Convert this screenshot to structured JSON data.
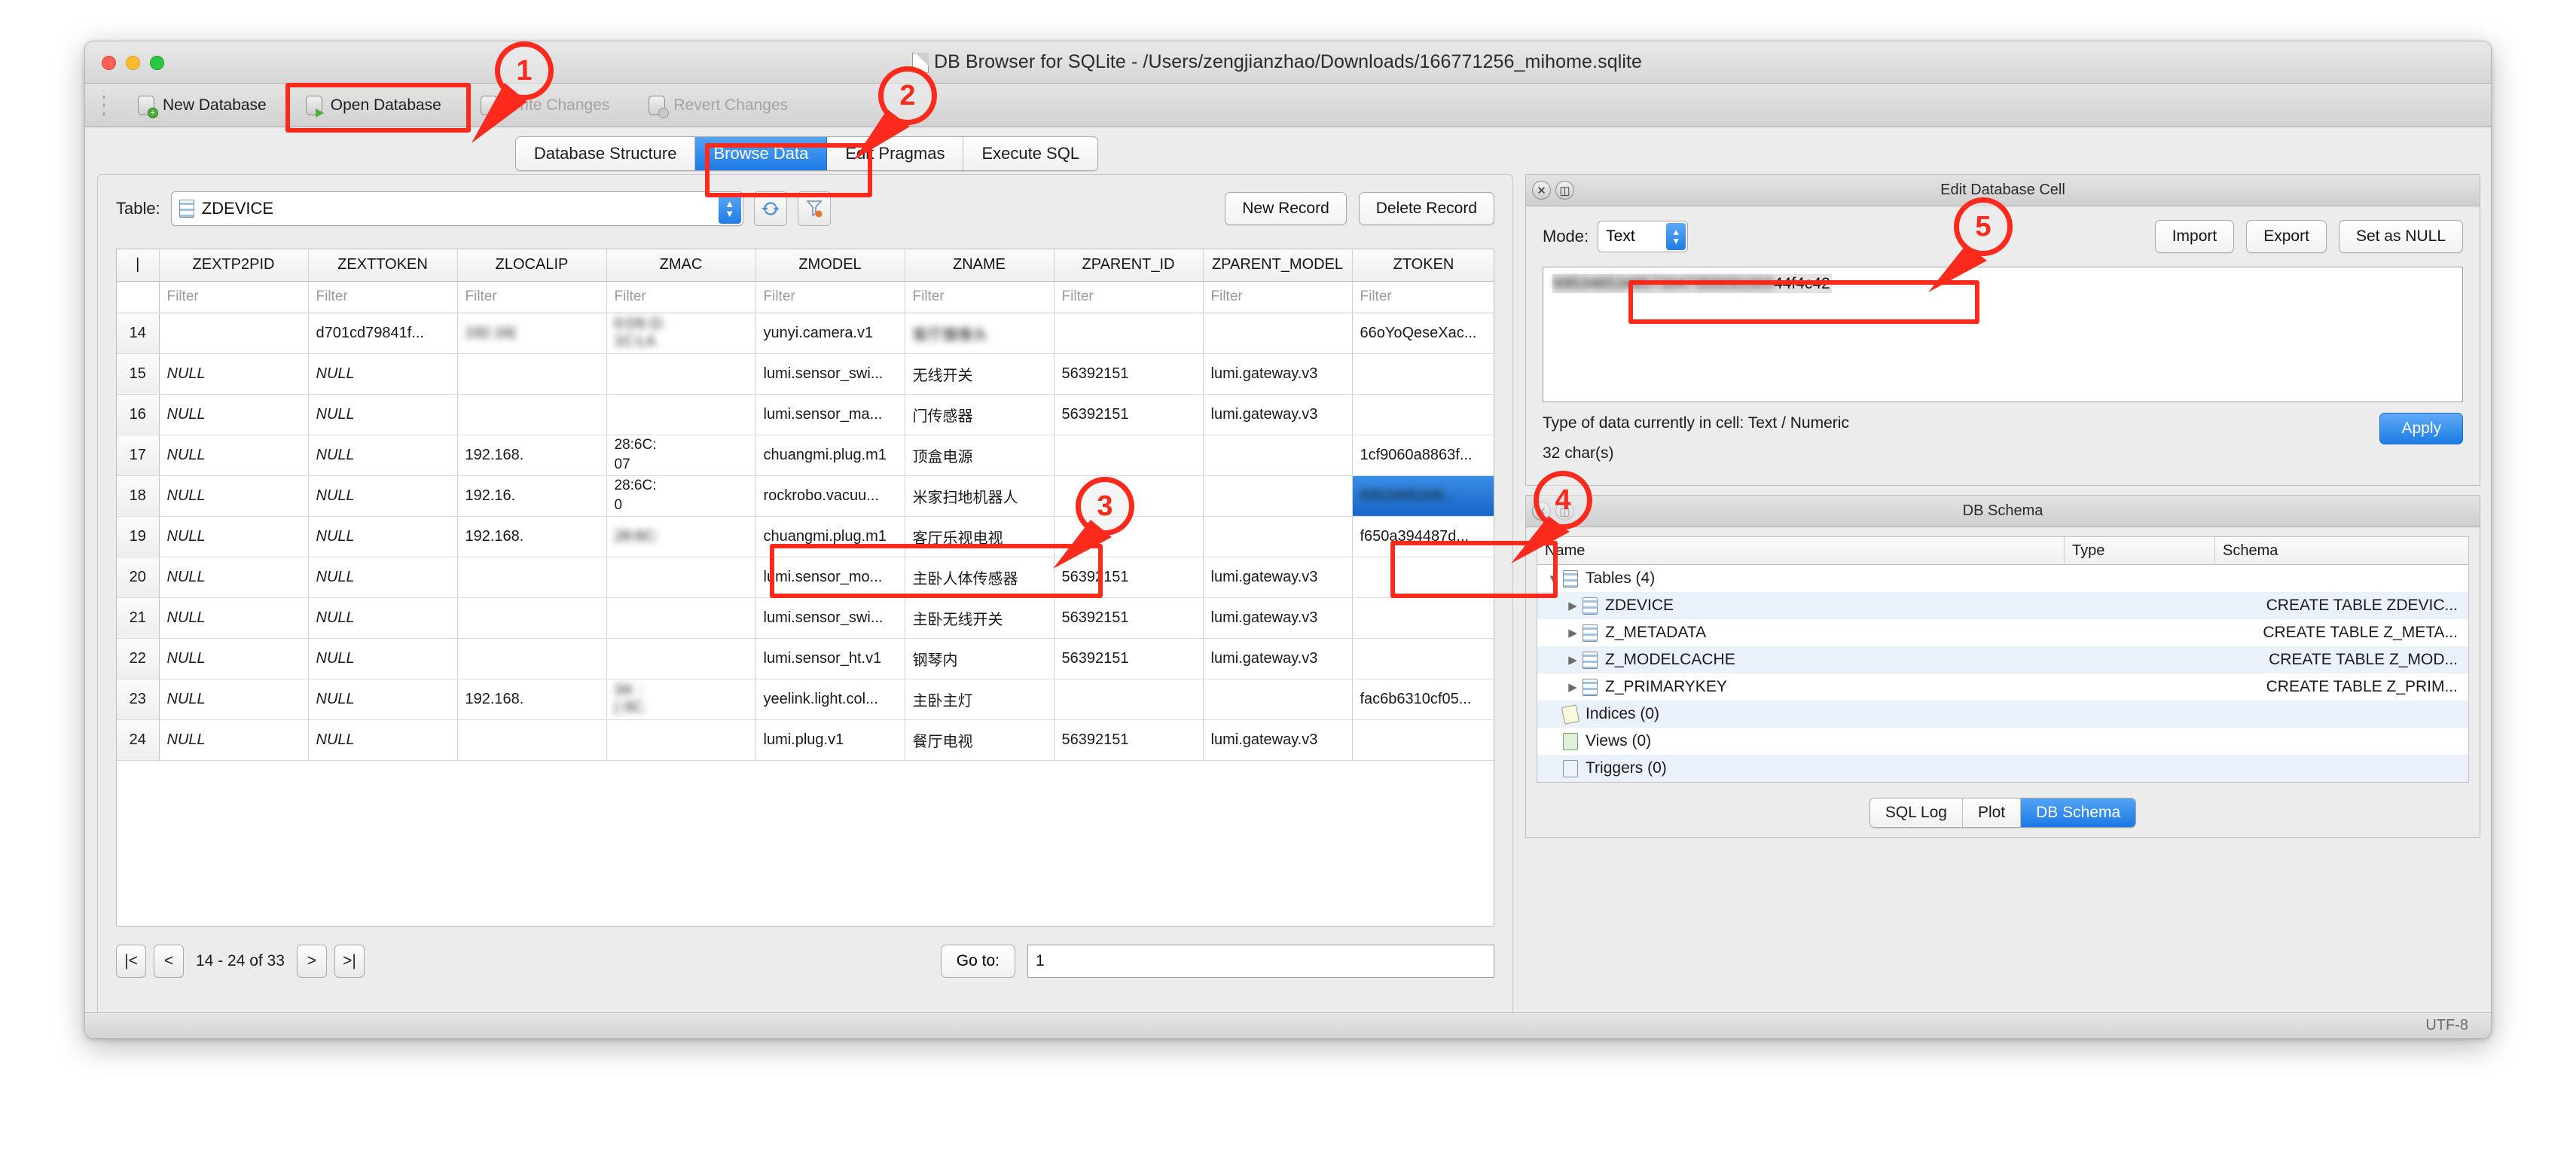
{
  "window": {
    "title": "DB Browser for SQLite - /Users/zengjianzhao/Downloads/166771256_mihome.sqlite",
    "status_encoding": "UTF-8"
  },
  "toolbar": {
    "new_database": "New Database",
    "open_database": "Open Database",
    "write_changes": "Write Changes",
    "revert_changes": "Revert Changes"
  },
  "tabs": [
    {
      "label": "Database Structure",
      "active": false
    },
    {
      "label": "Browse Data",
      "active": true
    },
    {
      "label": "Edit Pragmas",
      "active": false
    },
    {
      "label": "Execute SQL",
      "active": false
    }
  ],
  "browse": {
    "table_label": "Table:",
    "table_value": "ZDEVICE",
    "refresh_icon": "refresh-icon",
    "filter_icon": "clear-filter-icon",
    "new_record": "New Record",
    "delete_record": "Delete Record",
    "filter_placeholder": "Filter",
    "columns": [
      "ZEXTP2PID",
      "ZEXTTOKEN",
      "ZLOCALIP",
      "ZMAC",
      "ZMODEL",
      "ZNAME",
      "ZPARENT_ID",
      "ZPARENT_MODEL",
      "ZTOKEN"
    ],
    "rows": [
      {
        "n": "14",
        "cells": [
          "",
          "d701cd79841f...",
          "192.16(",
          "0:D5  D:\n1C:L4.",
          "yunyi.camera.v1",
          "客厅摄像头",
          "",
          "",
          "66oYoQeseXac..."
        ],
        "blur": [
          false,
          false,
          true,
          true,
          false,
          true,
          false,
          false,
          false
        ],
        "null": [
          false,
          false,
          false,
          false,
          false,
          false,
          false,
          false,
          false
        ],
        "sel": -1
      },
      {
        "n": "15",
        "cells": [
          "NULL",
          "NULL",
          "",
          "",
          "lumi.sensor_swi...",
          "无线开关",
          "56392151",
          "lumi.gateway.v3",
          ""
        ],
        "blur": [
          false,
          false,
          false,
          false,
          false,
          false,
          false,
          false,
          false
        ],
        "null": [
          true,
          true,
          false,
          false,
          false,
          false,
          false,
          false,
          false
        ],
        "sel": -1
      },
      {
        "n": "16",
        "cells": [
          "NULL",
          "NULL",
          "",
          "",
          "lumi.sensor_ma...",
          "门传感器",
          "56392151",
          "lumi.gateway.v3",
          ""
        ],
        "blur": [
          false,
          false,
          false,
          false,
          false,
          false,
          false,
          false,
          false
        ],
        "null": [
          true,
          true,
          false,
          false,
          false,
          false,
          false,
          false,
          false
        ],
        "sel": -1
      },
      {
        "n": "17",
        "cells": [
          "NULL",
          "NULL",
          "192.168.",
          "28:6C:\n07",
          "chuangmi.plug.m1",
          "顶盒电源",
          "",
          "",
          "1cf9060a8863f..."
        ],
        "blur": [
          false,
          false,
          false,
          false,
          false,
          false,
          false,
          false,
          false
        ],
        "null": [
          true,
          true,
          false,
          false,
          false,
          false,
          false,
          false,
          false
        ],
        "sel": -1
      },
      {
        "n": "18",
        "cells": [
          "NULL",
          "NULL",
          "192.16.",
          "28:6C:\n0",
          "rockrobo.vacuu...",
          "米家扫地机器人",
          "",
          "",
          "6953465348..."
        ],
        "blur": [
          false,
          false,
          false,
          false,
          false,
          false,
          false,
          false,
          true
        ],
        "null": [
          true,
          true,
          false,
          false,
          false,
          false,
          false,
          false,
          false
        ],
        "sel": 8
      },
      {
        "n": "19",
        "cells": [
          "NULL",
          "NULL",
          "192.168.",
          "28:6C:",
          "chuangmi.plug.m1",
          "客厅乐视电视",
          "",
          "",
          "f650a394487d..."
        ],
        "blur": [
          false,
          false,
          false,
          true,
          false,
          false,
          false,
          false,
          false
        ],
        "null": [
          true,
          true,
          false,
          false,
          false,
          false,
          false,
          false,
          false
        ],
        "sel": -1
      },
      {
        "n": "20",
        "cells": [
          "NULL",
          "NULL",
          "",
          "",
          "lumi.sensor_mo...",
          "主卧人体传感器",
          "56392151",
          "lumi.gateway.v3",
          ""
        ],
        "blur": [
          false,
          false,
          false,
          false,
          false,
          false,
          false,
          false,
          false
        ],
        "null": [
          true,
          true,
          false,
          false,
          false,
          false,
          false,
          false,
          false
        ],
        "sel": -1
      },
      {
        "n": "21",
        "cells": [
          "NULL",
          "NULL",
          "",
          "",
          "lumi.sensor_swi...",
          "主卧无线开关",
          "56392151",
          "lumi.gateway.v3",
          ""
        ],
        "blur": [
          false,
          false,
          false,
          false,
          false,
          false,
          false,
          false,
          false
        ],
        "null": [
          true,
          true,
          false,
          false,
          false,
          false,
          false,
          false,
          false
        ],
        "sel": -1
      },
      {
        "n": "22",
        "cells": [
          "NULL",
          "NULL",
          "",
          "",
          "lumi.sensor_ht.v1",
          "钢琴内",
          "56392151",
          "lumi.gateway.v3",
          ""
        ],
        "blur": [
          false,
          false,
          false,
          false,
          false,
          false,
          false,
          false,
          false
        ],
        "null": [
          true,
          true,
          false,
          false,
          false,
          false,
          false,
          false,
          false
        ],
        "sel": -1
      },
      {
        "n": "23",
        "cells": [
          "NULL",
          "NULL",
          "192.168.",
          "34:  :\n(  0C.",
          "yeelink.light.col...",
          "主卧主灯",
          "",
          "",
          "fac6b6310cf05..."
        ],
        "blur": [
          false,
          false,
          false,
          true,
          false,
          false,
          false,
          false,
          false
        ],
        "null": [
          true,
          true,
          false,
          false,
          false,
          false,
          false,
          false,
          false
        ],
        "sel": -1
      },
      {
        "n": "24",
        "cells": [
          "NULL",
          "NULL",
          "",
          "",
          "lumi.plug.v1",
          "餐厅电视",
          "56392151",
          "lumi.gateway.v3",
          ""
        ],
        "blur": [
          false,
          false,
          false,
          false,
          false,
          false,
          false,
          false,
          false
        ],
        "null": [
          true,
          true,
          false,
          false,
          false,
          false,
          false,
          false,
          false
        ],
        "sel": -1
      }
    ],
    "pager": {
      "first": "|<",
      "prev": "<",
      "next": ">",
      "last": ">|",
      "info": "14 - 24 of 33",
      "goto_label": "Go to:",
      "goto_value": "1"
    }
  },
  "edit_cell": {
    "panel_title": "Edit Database Cell",
    "mode_label": "Mode:",
    "mode_value": "Text",
    "import": "Import",
    "export": "Export",
    "set_null": "Set as NULL",
    "cell_value_blurred": "6953465348573047355091003",
    "cell_value_visible": "44f4c42",
    "type_line": "Type of data currently in cell: Text / Numeric",
    "chars_line": "32 char(s)",
    "apply": "Apply"
  },
  "db_schema": {
    "panel_title": "DB Schema",
    "columns": [
      "Name",
      "Type",
      "Schema"
    ],
    "rows": [
      {
        "indent": 0,
        "twisty": "▼",
        "icon": "table-icon",
        "name": "Tables (4)",
        "type": "",
        "schema": "",
        "alt": false
      },
      {
        "indent": 1,
        "twisty": "▶",
        "icon": "table-icon",
        "name": "ZDEVICE",
        "type": "",
        "schema": "CREATE TABLE ZDEVIC...",
        "alt": true
      },
      {
        "indent": 1,
        "twisty": "▶",
        "icon": "table-icon",
        "name": "Z_METADATA",
        "type": "",
        "schema": "CREATE TABLE Z_META...",
        "alt": false
      },
      {
        "indent": 1,
        "twisty": "▶",
        "icon": "table-icon",
        "name": "Z_MODELCACHE",
        "type": "",
        "schema": "CREATE TABLE Z_MOD...",
        "alt": true
      },
      {
        "indent": 1,
        "twisty": "▶",
        "icon": "table-icon",
        "name": "Z_PRIMARYKEY",
        "type": "",
        "schema": "CREATE TABLE Z_PRIM...",
        "alt": false
      },
      {
        "indent": 0,
        "twisty": "",
        "icon": "tag-icon",
        "name": "Indices (0)",
        "type": "",
        "schema": "",
        "alt": true
      },
      {
        "indent": 0,
        "twisty": "",
        "icon": "view-icon",
        "name": "Views (0)",
        "type": "",
        "schema": "",
        "alt": false
      },
      {
        "indent": 0,
        "twisty": "",
        "icon": "trigger-icon",
        "name": "Triggers (0)",
        "type": "",
        "schema": "",
        "alt": true
      }
    ],
    "bottom_tabs": [
      {
        "label": "SQL Log",
        "active": false
      },
      {
        "label": "Plot",
        "active": false
      },
      {
        "label": "DB Schema",
        "active": true
      }
    ]
  },
  "annotations": [
    {
      "id": "1",
      "target": "open-database-button"
    },
    {
      "id": "2",
      "target": "browse-data-tab"
    },
    {
      "id": "3",
      "target": "row-18-model-name"
    },
    {
      "id": "4",
      "target": "row-18-ztoken-cell"
    },
    {
      "id": "5",
      "target": "edit-cell-value"
    }
  ],
  "colors": {
    "annotation": "#fb2a1d",
    "accent_blue": "#1d7ce5",
    "selection_blue": "#1766c8"
  }
}
